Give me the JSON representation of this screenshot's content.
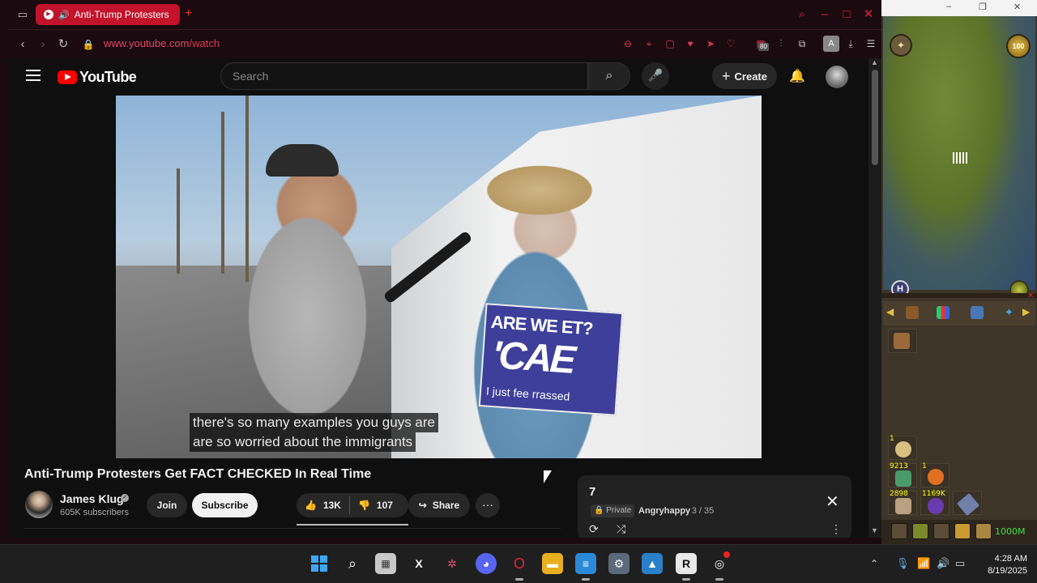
{
  "browser": {
    "tab_title": "Anti-Trump Protesters",
    "url_host": "www.youtube.com",
    "url_path": "/watch",
    "extension_badge": "80",
    "profile_initial": "A"
  },
  "youtube": {
    "logo_text": "YouTube",
    "search_placeholder": "Search",
    "create_label": "Create",
    "caption_line1": "there's so many examples you guys are",
    "caption_line2": "are so worried about the immigrants",
    "video_title": "Anti-Trump Protesters Get FACT CHECKED In Real Time",
    "channel_name": "James Klug",
    "channel_subs": "605K subscribers",
    "join_label": "Join",
    "subscribe_label": "Subscribe",
    "likes": "13K",
    "dislikes": "107",
    "share_label": "Share",
    "sign_line1": "ARE WE",
    "sign_line1b": "ET?",
    "sign_line2": "'CA",
    "sign_line2b": "E",
    "sign_line3": "I just fee",
    "sign_line3b": "rrassed"
  },
  "playlist": {
    "title": "7",
    "privacy": "Private",
    "owner": "Angryhappy",
    "position": "- 3 / 35"
  },
  "game": {
    "orb_value": "100",
    "qty_1": "1",
    "qty_2": "9213",
    "qty_3": "1",
    "qty_4": "2898",
    "qty_5": "1169K",
    "money": "1000M",
    "colors": {
      "minimap_land": "#5c7228",
      "minimap_water": "#2f4b6c",
      "qty_text": "#ffff00",
      "money_text": "#40e040"
    }
  },
  "taskbar": {
    "time": "4:28 AM",
    "date": "8/19/2025"
  },
  "colors": {
    "browser_frame": "#1b0a10",
    "tab_active": "#c2132b",
    "yt_background": "#0f0f0f",
    "yt_red": "#ff0000"
  }
}
